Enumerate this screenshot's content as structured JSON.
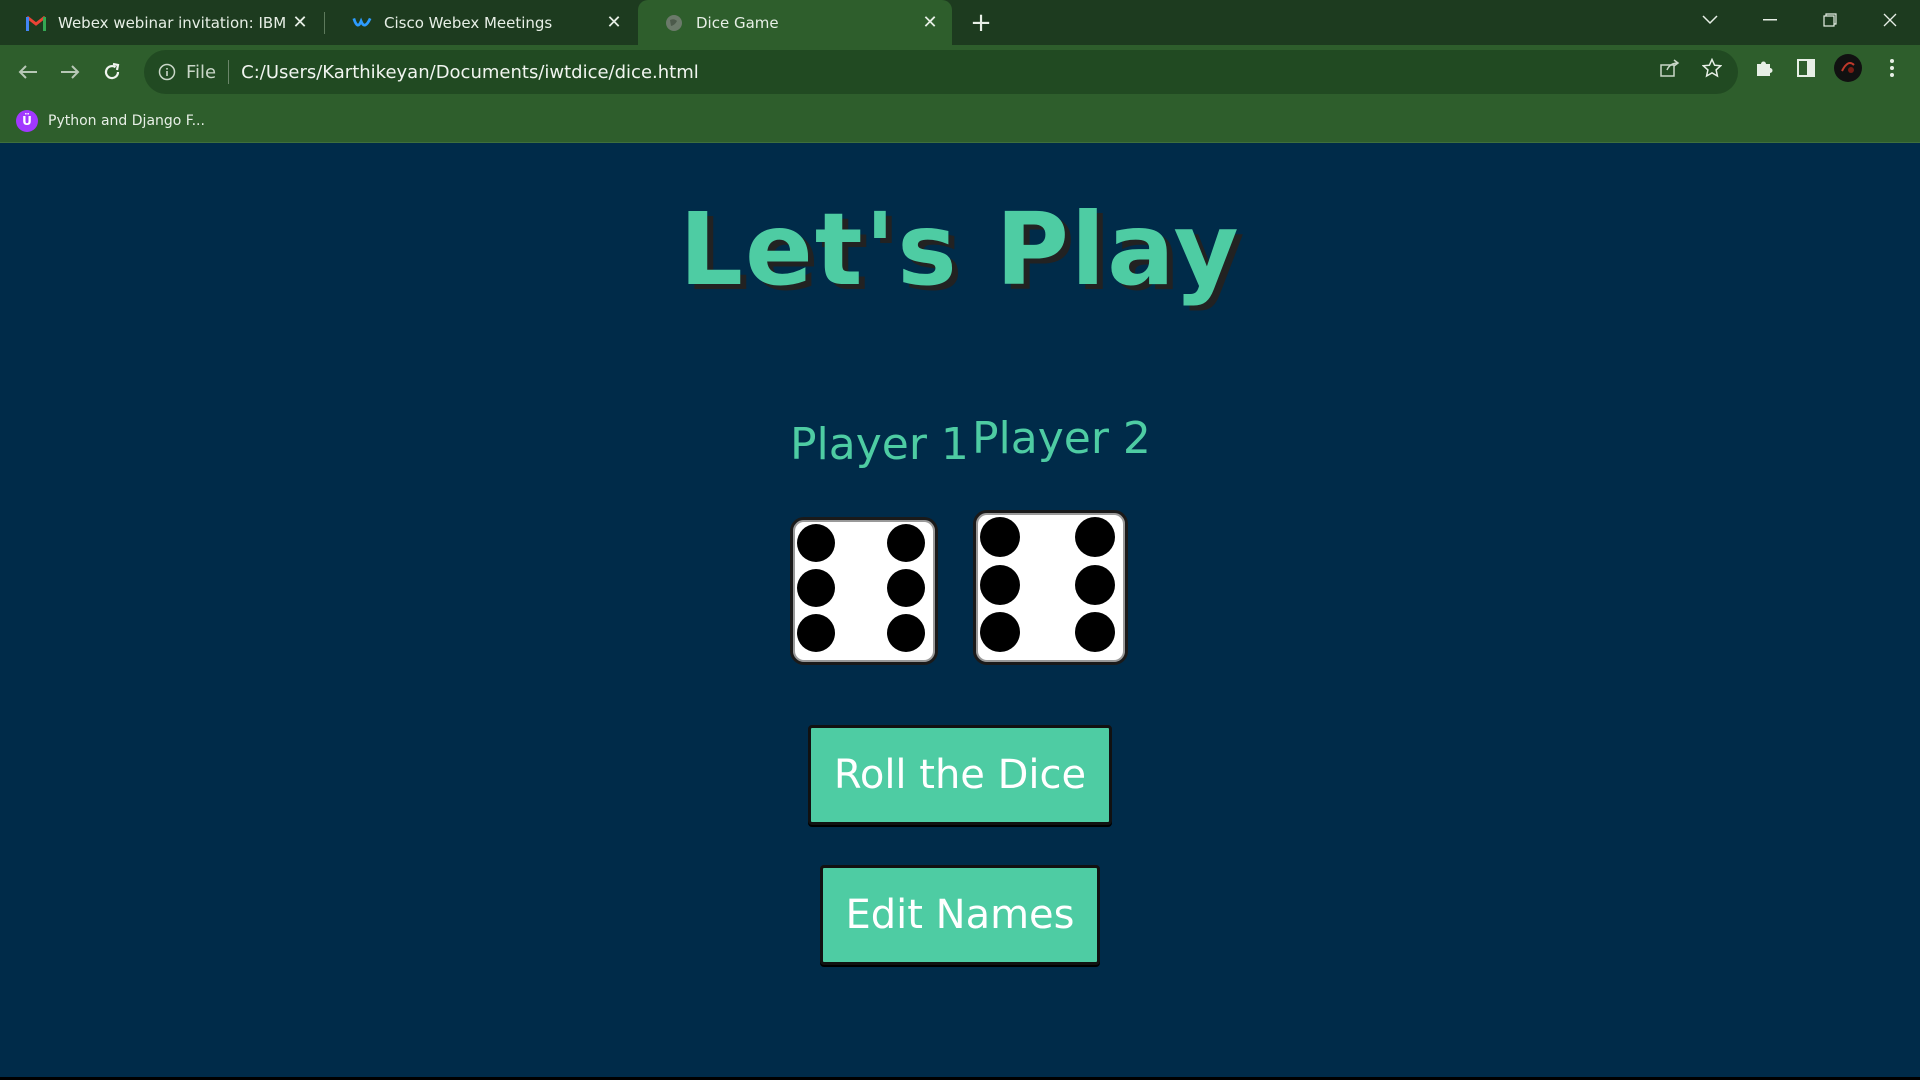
{
  "browser": {
    "tabs": [
      {
        "title": "Webex webinar invitation: IBM Naan",
        "icon": "gmail-icon"
      },
      {
        "title": "Cisco Webex Meetings",
        "icon": "webex-icon"
      },
      {
        "title": "Dice Game",
        "icon": "globe-icon"
      }
    ],
    "address": {
      "scheme_label": "File",
      "url": "C:/Users/Karthikeyan/Documents/iwtdice/dice.html"
    },
    "bookmarks": [
      {
        "label": "Python and Django F...",
        "icon": "udemy-icon"
      }
    ]
  },
  "page": {
    "heading": "Let's Play",
    "players": [
      {
        "name": "Player 1",
        "die_value": 6
      },
      {
        "name": "Player 2",
        "die_value": 6
      }
    ],
    "roll_button": "Roll the Dice",
    "edit_button": "Edit Names"
  },
  "colors": {
    "background": "#002b49",
    "accent": "#4ecca3",
    "chrome_dark": "#1d3b1f",
    "chrome": "#2e5e2c"
  }
}
